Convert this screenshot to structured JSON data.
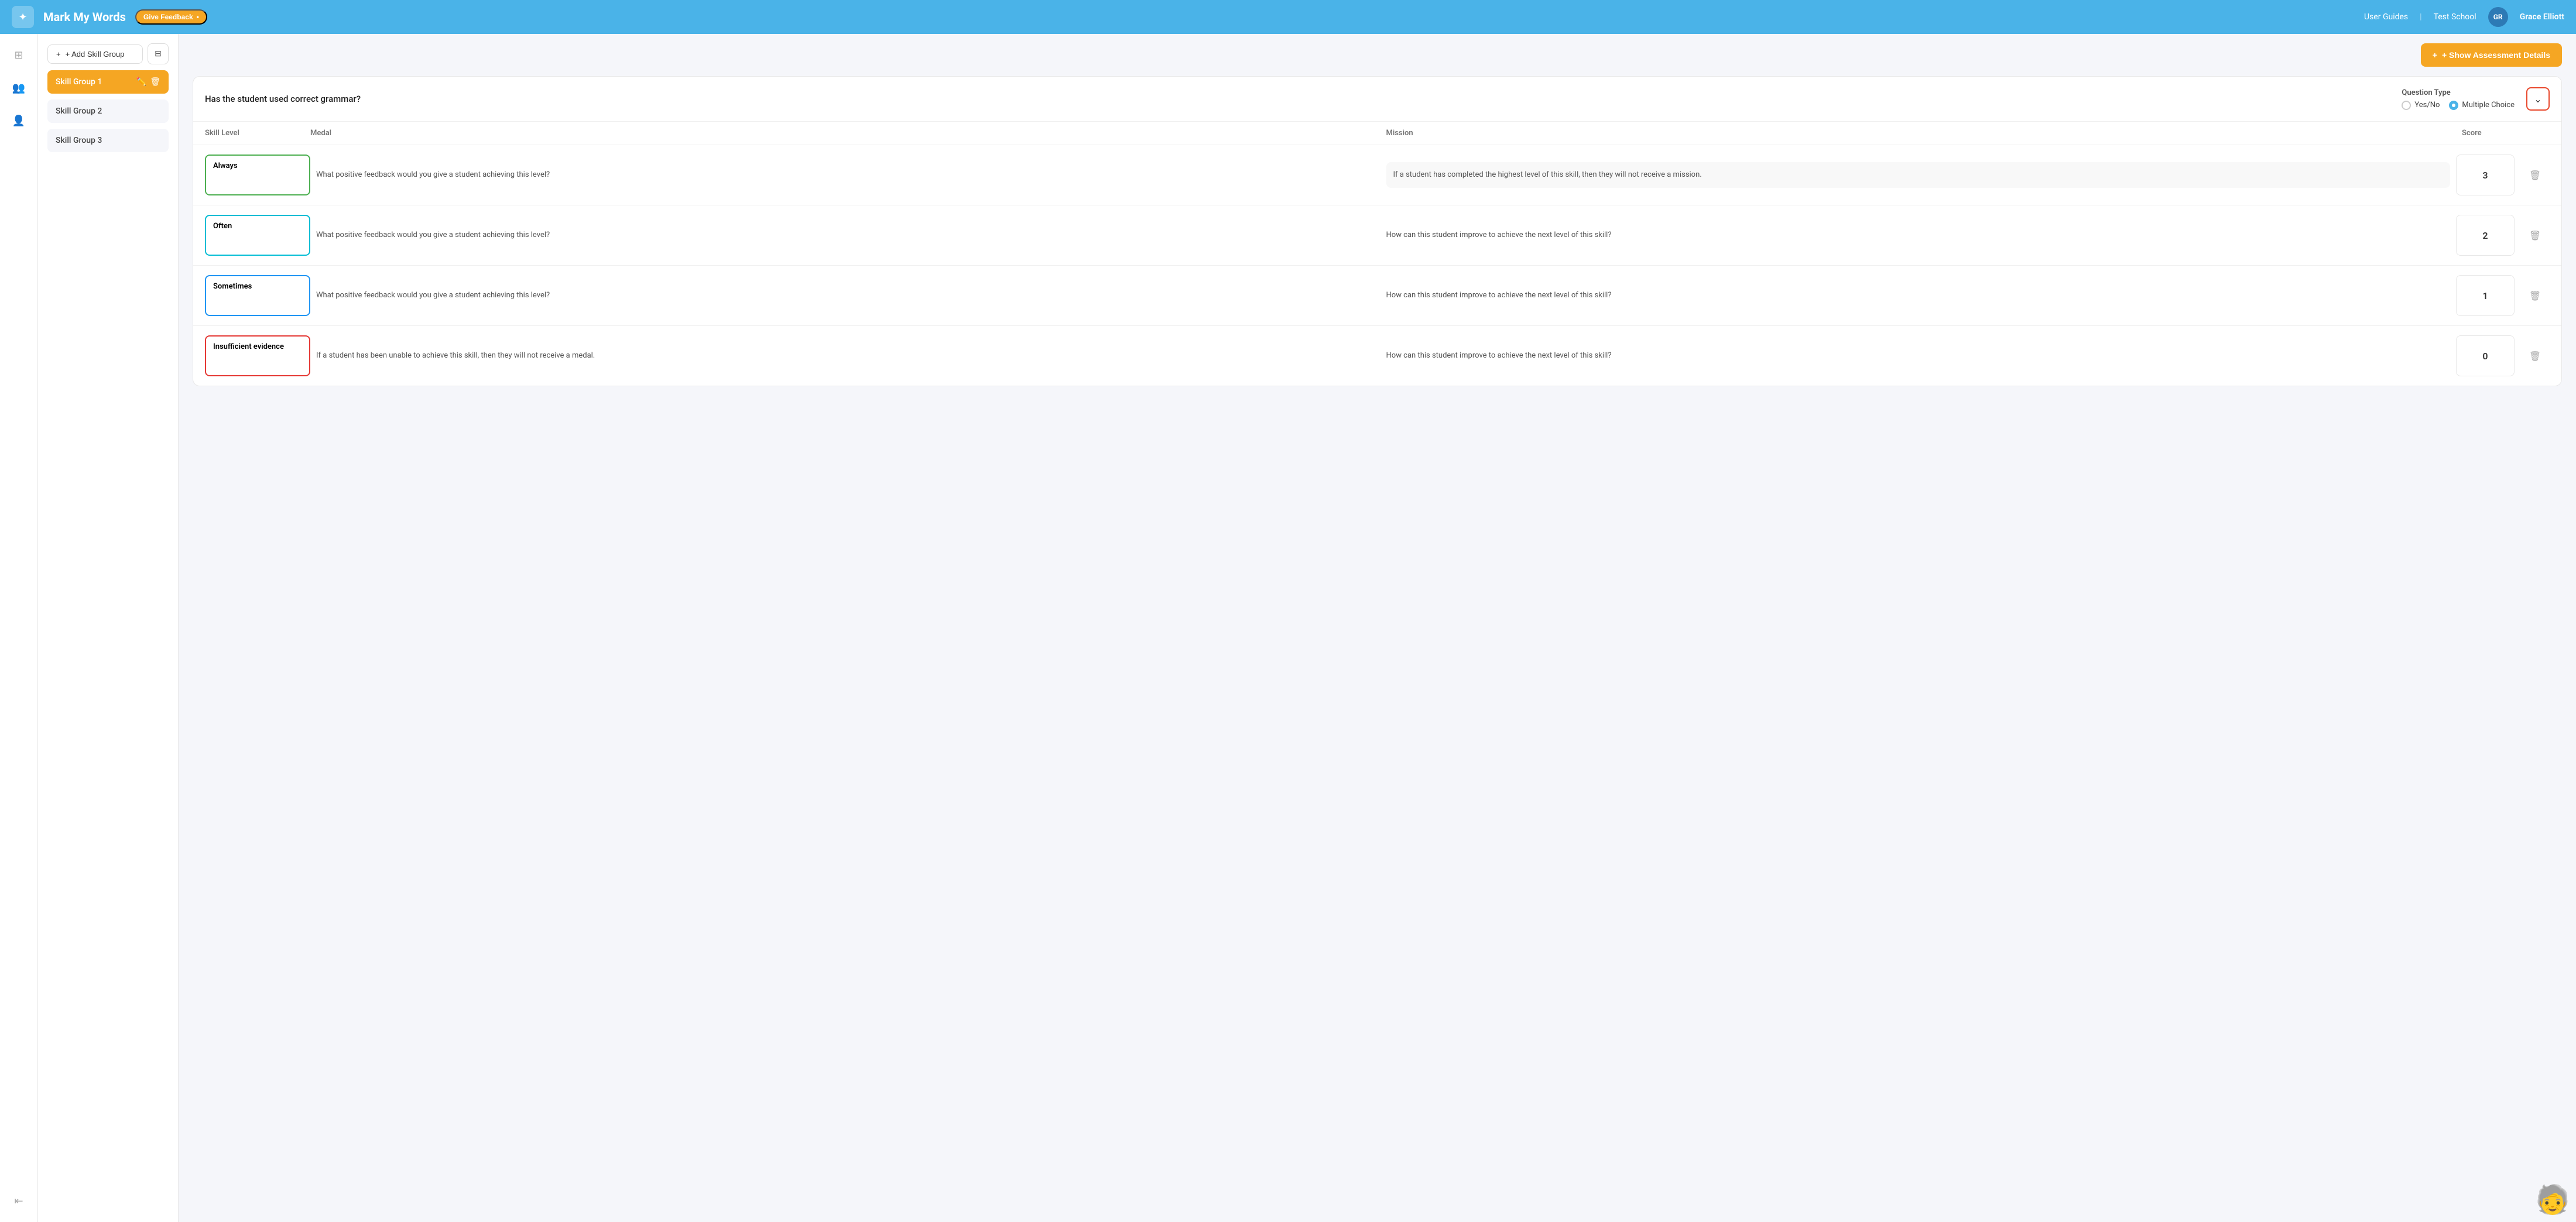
{
  "header": {
    "logo_icon": "✦",
    "title": "Mark My Words",
    "feedback_label": "Give Feedback",
    "feedback_dot": "•",
    "nav": {
      "user_guides": "User Guides",
      "school": "Test School",
      "avatar_initials": "GR",
      "user_name": "Grace Elliott"
    }
  },
  "sidebar": {
    "add_button_label": "+ Add Skill Group",
    "skill_groups": [
      {
        "id": 1,
        "label": "Skill Group 1",
        "active": true
      },
      {
        "id": 2,
        "label": "Skill Group 2",
        "active": false
      },
      {
        "id": 3,
        "label": "Skill Group 3",
        "active": false
      }
    ]
  },
  "main": {
    "show_assessment_btn": "+ Show Assessment Details",
    "question": {
      "text": "Has the student used correct grammar?",
      "type_label": "Question Type",
      "options": [
        {
          "id": "yes_no",
          "label": "Yes/No",
          "selected": false
        },
        {
          "id": "multiple_choice",
          "label": "Multiple Choice",
          "selected": true
        }
      ]
    },
    "table": {
      "headers": [
        "Skill Level",
        "Medal",
        "Mission",
        "Score",
        ""
      ],
      "rows": [
        {
          "skill_level": "Always",
          "skill_color": "green",
          "medal": "What positive feedback would you give a student achieving this level?",
          "mission": "If a student has completed the highest level of this skill, then they will not receive a mission.",
          "mission_highlighted": true,
          "score": "3"
        },
        {
          "skill_level": "Often",
          "skill_color": "cyan",
          "medal": "What positive feedback would you give a student achieving this level?",
          "mission": "How can this student improve to achieve the next level of this skill?",
          "mission_highlighted": false,
          "score": "2"
        },
        {
          "skill_level": "Sometimes",
          "skill_color": "blue",
          "medal": "What positive feedback would you give a student achieving this level?",
          "mission": "How can this student improve to achieve the next level of this skill?",
          "mission_highlighted": false,
          "score": "1"
        },
        {
          "skill_level": "Insufficient evidence",
          "skill_color": "red",
          "medal": "If a student has been unable to achieve this skill, then they will not receive a medal.",
          "mission": "How can this student improve to achieve the next level of this skill?",
          "mission_highlighted": false,
          "score": "0"
        }
      ]
    }
  }
}
